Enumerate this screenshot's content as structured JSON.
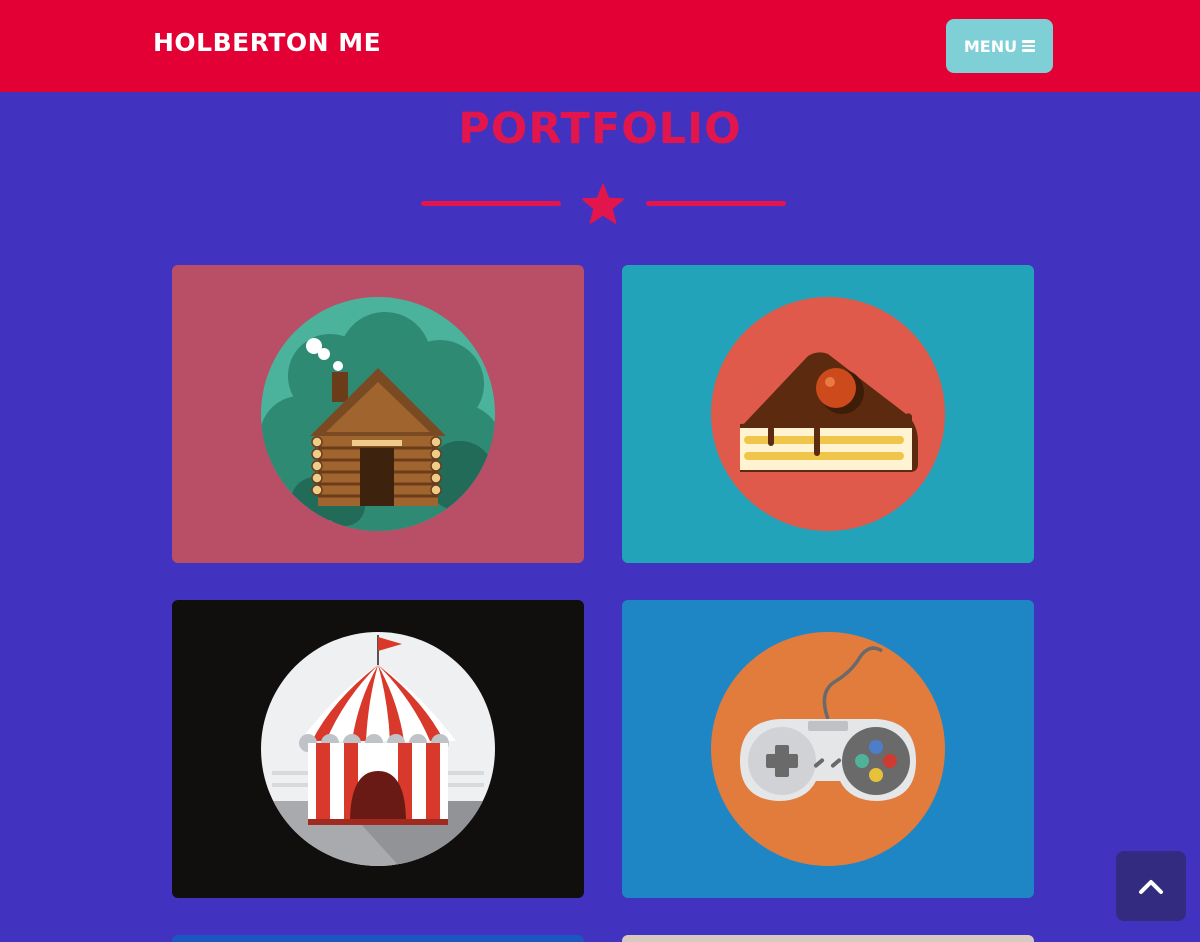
{
  "header": {
    "brand": "HOLBERTON ME",
    "menu_label": "MENU",
    "menu_icon": "bars-icon"
  },
  "section": {
    "title": "PORTFOLIO",
    "divider_icon": "star-icon"
  },
  "portfolio": {
    "items": [
      {
        "name": "cabin",
        "icon": "log-cabin-illustration"
      },
      {
        "name": "cake",
        "icon": "cake-slice-illustration"
      },
      {
        "name": "circus",
        "icon": "circus-tent-illustration"
      },
      {
        "name": "game",
        "icon": "game-controller-illustration"
      },
      {
        "name": "item-5",
        "icon": "partial-thumbnail"
      },
      {
        "name": "item-6",
        "icon": "partial-thumbnail"
      }
    ]
  },
  "controls": {
    "scroll_top_icon": "chevron-up-icon"
  },
  "colors": {
    "navbar": "#e20034",
    "page_background": "#4132c0",
    "accent": "#e2164c",
    "menu_button": "#7fcfd6",
    "scroll_top_button": "#332b7f"
  },
  "section_background": "#4132c0"
}
